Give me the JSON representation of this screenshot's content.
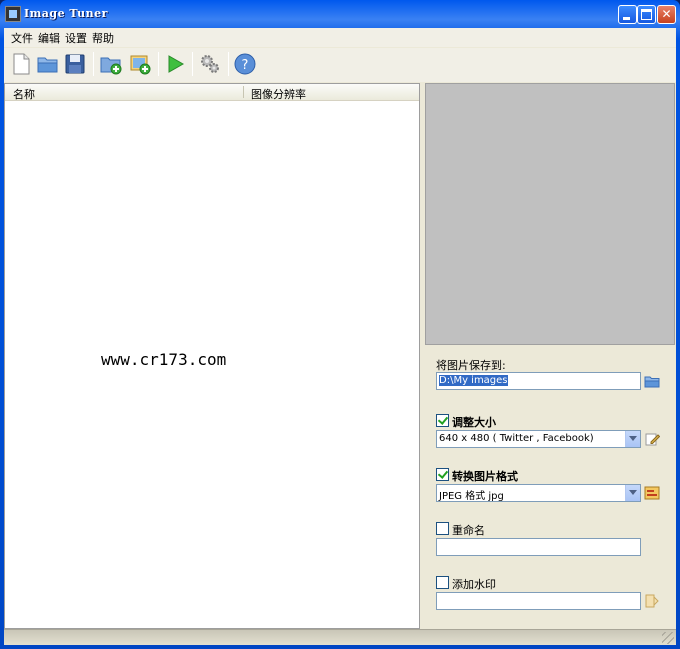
{
  "window": {
    "title": "Image Tuner"
  },
  "menu": {
    "file": "文件",
    "edit": "编辑",
    "settings": "设置",
    "help": "帮助"
  },
  "list": {
    "col_name": "名称",
    "col_resolution": "图像分辨率",
    "watermark": "www.cr173.com"
  },
  "save_to": {
    "label": "将图片保存到:",
    "path": "D:\\My images"
  },
  "resize": {
    "label": "调整大小",
    "checked": true,
    "value": "640 x 480 ( Twitter , Facebook)"
  },
  "convert": {
    "label": "转换图片格式",
    "checked": true,
    "value": "JPEG 格式 jpg"
  },
  "rename": {
    "label": "重命名",
    "checked": false,
    "value": ""
  },
  "watermark_opt": {
    "label": "添加水印",
    "checked": false,
    "value": ""
  },
  "colors": {
    "titlebar": "#0054e3",
    "client": "#ece9d8",
    "preview": "#c0c0c0",
    "selection": "#316ac5"
  }
}
